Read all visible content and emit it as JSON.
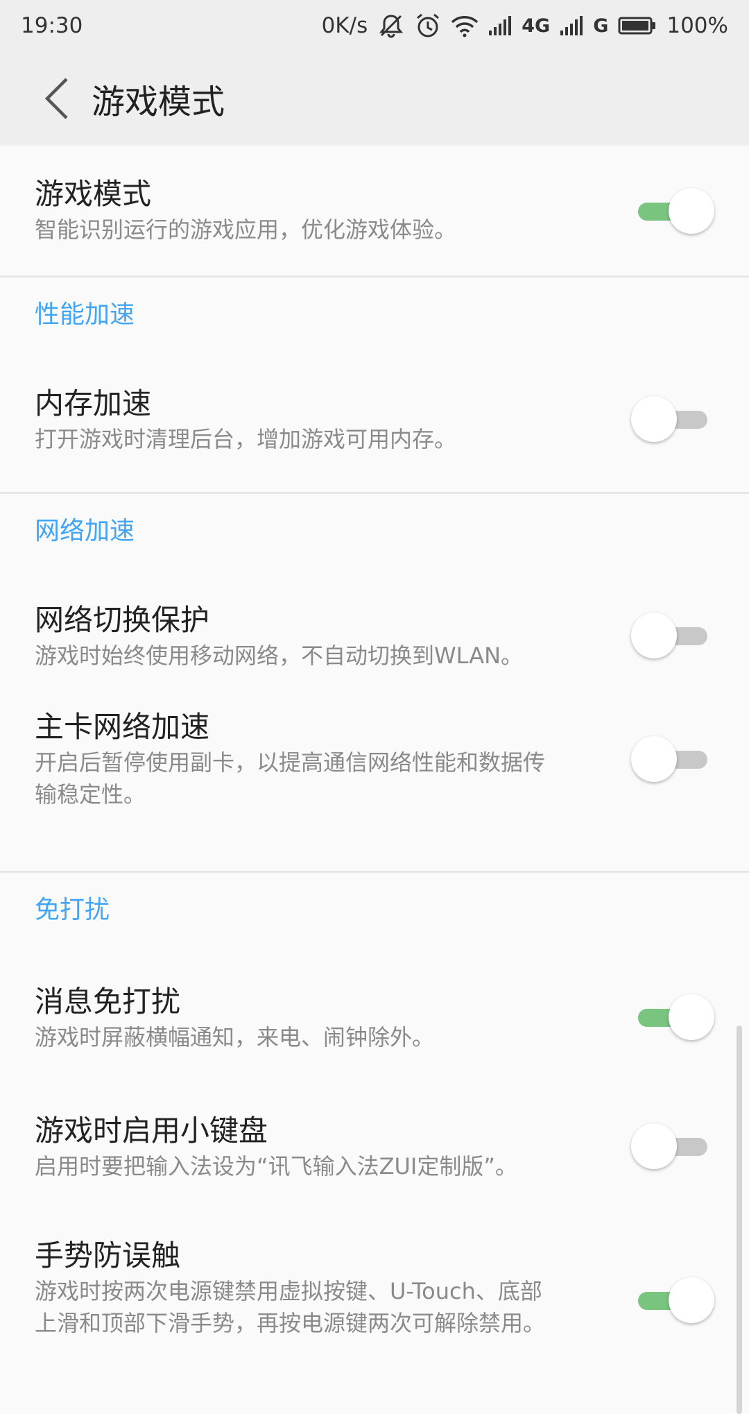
{
  "status_bar": {
    "time": "19:30",
    "net_speed": "0K/s",
    "sim1_type": "4G",
    "sim2_type": "G",
    "battery": "100%",
    "icons": [
      "mute-icon",
      "alarm-icon",
      "wifi-icon",
      "signal-icon",
      "signal-icon",
      "battery-icon"
    ]
  },
  "app_bar": {
    "title": "游戏模式"
  },
  "rows": {
    "game_mode": {
      "title": "游戏模式",
      "subtitle": "智能识别运行的游戏应用，优化游戏体验。",
      "enabled": true
    },
    "memory_boost": {
      "title": "内存加速",
      "subtitle": "打开游戏时清理后台，增加游戏可用内存。",
      "enabled": false
    },
    "network_protect": {
      "title": "网络切换保护",
      "subtitle": "游戏时始终使用移动网络，不自动切换到WLAN。",
      "enabled": false
    },
    "primary_sim_boost": {
      "title": "主卡网络加速",
      "subtitle": "开启后暂停使用副卡，以提高通信网络性能和数据传输稳定性。",
      "enabled": false
    },
    "msg_dnd": {
      "title": "消息免打扰",
      "subtitle": "游戏时屏蔽横幅通知，来电、闹钟除外。",
      "enabled": true
    },
    "small_keyboard": {
      "title": "游戏时启用小键盘",
      "subtitle": "启用时要把输入法设为“讯飞输入法ZUI定制版”。",
      "enabled": false
    },
    "gesture_guard": {
      "title": "手势防误触",
      "subtitle": "游戏时按两次电源键禁用虚拟按键、U-Touch、底部上滑和顶部下滑手势，再按电源键两次可解除禁用。",
      "enabled": true
    }
  },
  "sections": {
    "performance": "性能加速",
    "network": "网络加速",
    "dnd": "免打扰"
  },
  "colors": {
    "accent": "#42a5f5",
    "switch_on": "#79c47f",
    "switch_off": "#c8c8c8"
  }
}
